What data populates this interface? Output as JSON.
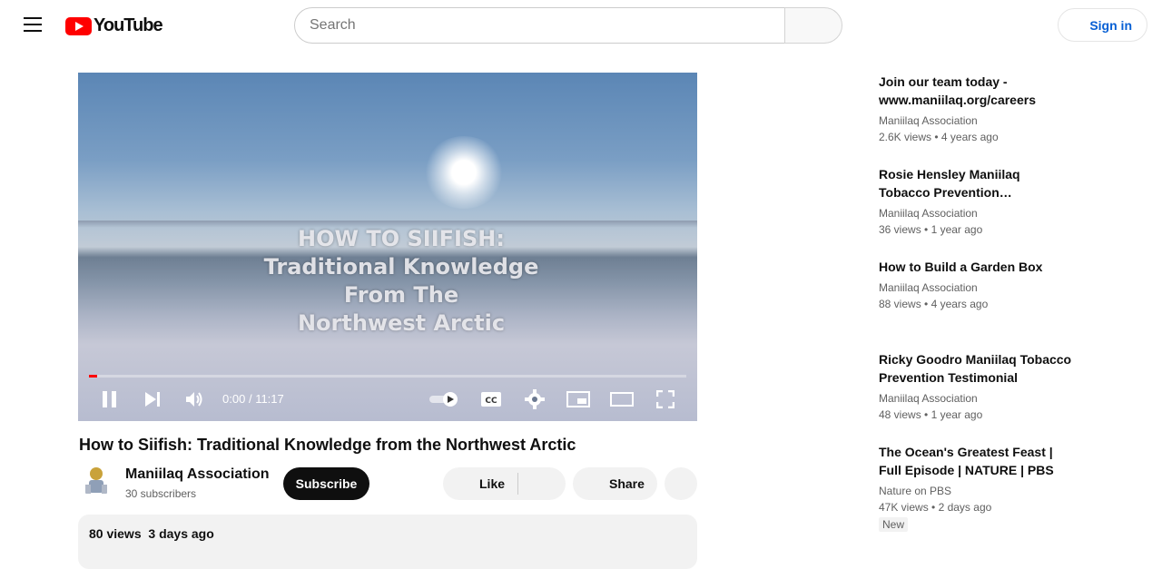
{
  "header": {
    "logo_text": "YouTube",
    "search_placeholder": "Search",
    "sign_in_label": "Sign in"
  },
  "player": {
    "overlay_lines": [
      "HOW TO SIIFISH:",
      "Traditional Knowledge",
      "From The",
      "Northwest Arctic"
    ],
    "time_current": "0:00",
    "time_separator": "/",
    "time_total": "11:17",
    "progress": 0.013
  },
  "video": {
    "title": "How to Siifish: Traditional Knowledge from the Northwest Arctic",
    "channel_name": "Maniilaq Association",
    "subscribers": "30 subscribers",
    "subscribe_label": "Subscribe",
    "like_label": "Like",
    "share_label": "Share",
    "views": "80 views",
    "date": "3 days ago"
  },
  "recommendations": [
    {
      "title_line1": "Join our team today -",
      "title_line2": "www.maniilaq.org/careers",
      "channel": "Maniilaq Association",
      "views": "2.6K views",
      "age": "4 years ago",
      "badge": ""
    },
    {
      "title_line1": "Rosie Hensley Maniilaq",
      "title_line2": "Tobacco Prevention…",
      "channel": "Maniilaq Association",
      "views": "36 views",
      "age": "1 year ago",
      "badge": ""
    },
    {
      "title_line1": "How to Build a Garden Box",
      "title_line2": "",
      "channel": "Maniilaq Association",
      "views": "88 views",
      "age": "4 years ago",
      "badge": ""
    },
    {
      "title_line1": "Ricky Goodro Maniilaq Tobacco",
      "title_line2": "Prevention Testimonial",
      "channel": "Maniilaq Association",
      "views": "48 views",
      "age": "1 year ago",
      "badge": ""
    },
    {
      "title_line1": "The Ocean's Greatest Feast |",
      "title_line2": "Full Episode | NATURE | PBS",
      "channel": "Nature on PBS",
      "views": "47K views",
      "age": "2 days ago",
      "badge": "New"
    }
  ]
}
